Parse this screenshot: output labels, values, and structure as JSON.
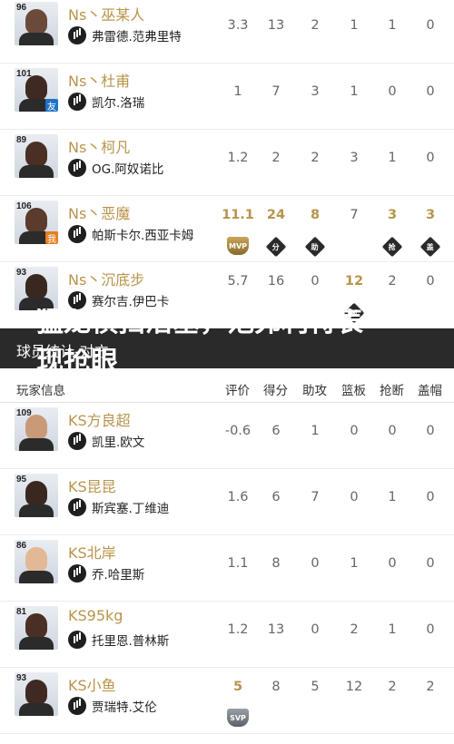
{
  "colors": {
    "gold": "#b8944b",
    "dark_bar": "#2a2a2a"
  },
  "caption": {
    "line1": "猛龙横扫活塞，范弗利特表",
    "line2": "现抢眼"
  },
  "section_title": "球员统计-对方",
  "table_header": {
    "player": "玩家信息",
    "rating": "评价",
    "pts": "得分",
    "ast": "助攻",
    "reb": "篮板",
    "stl": "抢断",
    "blk": "盖帽"
  },
  "team_ns": [
    {
      "ovr": "96",
      "player": "Ns丶巫某人",
      "real": "弗雷德.范弗里特",
      "tag": "",
      "rating": "3.3",
      "pts": "13",
      "ast": "2",
      "reb": "1",
      "stl": "1",
      "blk": "0",
      "badges": {}
    },
    {
      "ovr": "101",
      "player": "Ns丶杜甫",
      "real": "凯尔.洛瑞",
      "tag": "友",
      "rating": "1",
      "pts": "7",
      "ast": "3",
      "reb": "1",
      "stl": "0",
      "blk": "0",
      "badges": {}
    },
    {
      "ovr": "89",
      "player": "Ns丶柯凡",
      "real": "OG.阿奴诺比",
      "tag": "",
      "rating": "1.2",
      "pts": "2",
      "ast": "2",
      "reb": "3",
      "stl": "1",
      "blk": "0",
      "badges": {}
    },
    {
      "ovr": "106",
      "player": "Ns丶恶魔",
      "real": "帕斯卡尔.西亚卡姆",
      "tag": "我",
      "rating": "11.1",
      "pts": "24",
      "ast": "8",
      "reb": "7",
      "stl": "3",
      "blk": "3",
      "badges": {
        "rating": "MVP",
        "pts": "分",
        "ast": "助",
        "stl": "抢",
        "blk": "盖"
      }
    },
    {
      "ovr": "93",
      "player": "Ns丶沉底步",
      "real": "赛尔吉.伊巴卡",
      "tag": "",
      "rating": "5.7",
      "pts": "16",
      "ast": "0",
      "reb": "12",
      "stl": "2",
      "blk": "0",
      "badges": {
        "reb": "板"
      }
    }
  ],
  "team_ks": [
    {
      "ovr": "109",
      "player": "KS方良超",
      "real": "凯里.欧文",
      "rating": "-0.6",
      "pts": "6",
      "ast": "1",
      "reb": "0",
      "stl": "0",
      "blk": "0",
      "badges": {}
    },
    {
      "ovr": "95",
      "player": "KS昆昆",
      "real": "斯宾塞.丁维迪",
      "rating": "1.6",
      "pts": "6",
      "ast": "7",
      "reb": "0",
      "stl": "1",
      "blk": "0",
      "badges": {}
    },
    {
      "ovr": "86",
      "player": "KS北岸",
      "real": "乔.哈里斯",
      "rating": "1.1",
      "pts": "8",
      "ast": "0",
      "reb": "1",
      "stl": "0",
      "blk": "0",
      "badges": {}
    },
    {
      "ovr": "81",
      "player": "KS95kg",
      "real": "托里恩.普林斯",
      "rating": "1.2",
      "pts": "13",
      "ast": "0",
      "reb": "2",
      "stl": "1",
      "blk": "0",
      "badges": {}
    },
    {
      "ovr": "93",
      "player": "KS小鱼",
      "real": "贾瑞特.艾伦",
      "rating": "5",
      "pts": "8",
      "ast": "5",
      "reb": "12",
      "stl": "2",
      "blk": "2",
      "badges": {
        "rating": "SVP"
      }
    }
  ]
}
